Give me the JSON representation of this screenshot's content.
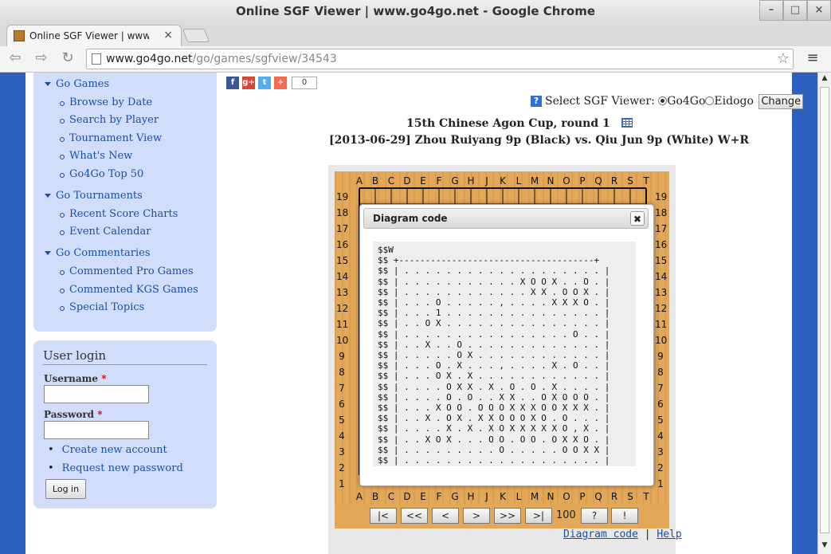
{
  "window": {
    "title": "Online SGF Viewer | www.go4go.net - Google Chrome",
    "controls": {
      "minimize": "–",
      "maximize": "□",
      "close": "×"
    }
  },
  "tab": {
    "title": "Online SGF Viewer | www.",
    "close": "×",
    "favicon": "go4go-favicon"
  },
  "toolbar": {
    "back": "back-icon",
    "forward": "forward-icon",
    "reload": "reload-icon",
    "url_host": "www.go4go.net",
    "url_path": "/go/games/sgfview/34543",
    "star": "star-icon",
    "menu": "menu-icon"
  },
  "sidebar": {
    "sections": [
      {
        "label": "Go Games",
        "items": [
          "Browse by Date",
          "Search by Player",
          "Tournament View",
          "What's New",
          "Go4Go Top 50"
        ]
      },
      {
        "label": "Go Tournaments",
        "items": [
          "Recent Score Charts",
          "Event Calendar"
        ]
      },
      {
        "label": "Go Commentaries",
        "items": [
          "Commented Pro Games",
          "Commented KGS Games",
          "Special Topics"
        ]
      }
    ]
  },
  "login": {
    "title": "User login",
    "username_label": "Username",
    "password_label": "Password",
    "required": "*",
    "username_value": "",
    "password_value": "",
    "create_account": "Create new account",
    "request_password": "Request new password",
    "button": "Log in"
  },
  "share": {
    "count": "0",
    "icons": [
      "facebook-icon",
      "google-plus-icon",
      "twitter-icon",
      "addthis-icon"
    ],
    "colors": {
      "facebook": "#3b5998",
      "google": "#d34836",
      "twitter": "#55acee",
      "addthis": "#f8694d"
    }
  },
  "viewer_select": {
    "label": "Select SGF Viewer:",
    "options": [
      "Go4Go",
      "Eidogo"
    ],
    "selected": "Go4Go",
    "button": "Change",
    "help": "?"
  },
  "game": {
    "title": "15th Chinese Agon Cup, round 1",
    "subtitle": "[2013-06-29] Zhou Ruiyang 9p (Black) vs. Qiu Jun 9p (White) W+R"
  },
  "board": {
    "columns": [
      "A",
      "B",
      "C",
      "D",
      "E",
      "F",
      "G",
      "H",
      "J",
      "K",
      "L",
      "M",
      "N",
      "O",
      "P",
      "Q",
      "R",
      "S",
      "T"
    ],
    "rows": [
      "19",
      "18",
      "17",
      "16",
      "15",
      "14",
      "13",
      "12",
      "11",
      "10",
      "9",
      "8",
      "7",
      "6",
      "5",
      "4",
      "3",
      "2",
      "1"
    ],
    "color": "#e3a758"
  },
  "controls": {
    "buttons": [
      "|<",
      "<<",
      "<",
      ">",
      ">>",
      ">|"
    ],
    "move": "100",
    "extra": [
      "?",
      "!"
    ],
    "diagram_code": "Diagram code",
    "separator": "|",
    "help": "Help"
  },
  "modal": {
    "title": "Diagram code",
    "close": "✖",
    "lines": [
      "$$W",
      "$$ +-------------------------------------+",
      "$$ | . . . . . . . . . . . . . . . . . . . |",
      "$$ | . . . . . . . . . . . X O O X . . O . |",
      "$$ | . . . . . . . . . . . . X X . O O X . |",
      "$$ | . . . O . . . . . , . . . . X X X O . |",
      "$$ | . . . 1 . . . . . . . . . . . . . . . |",
      "$$ | . . O X . . . . . . . . . . . . . . . |",
      "$$ | . . . . . . . . . . . . . . . . O . . |",
      "$$ | . . X . . O . . . . . . . . . . . . . |",
      "$$ | . . . . . O X . . . . . . . . . . . . |",
      "$$ | . . . O . X . . . , . . . . X . O . . |",
      "$$ | . . . O X . X . . . . . . . . . . . . |",
      "$$ | . . . . O X X . X . O . O . X . . . . |",
      "$$ | . . . . O . O . . X X . . O X O O O . |",
      "$$ | . . . X O O . O O O X X X O O X X X . |",
      "$$ | . . X . O X . X X O O O X O . O . . . |",
      "$$ | . . . . X . X . X O X X X X X O , X . |",
      "$$ | . . X O X . . . O O . O O . O X X O . |",
      "$$ | . . . . . . . . . O . . . . . O O X X |",
      "$$ | . . . . . . . . . . . . . . . . . . . |",
      "$$ +-------------------------------------+"
    ]
  }
}
